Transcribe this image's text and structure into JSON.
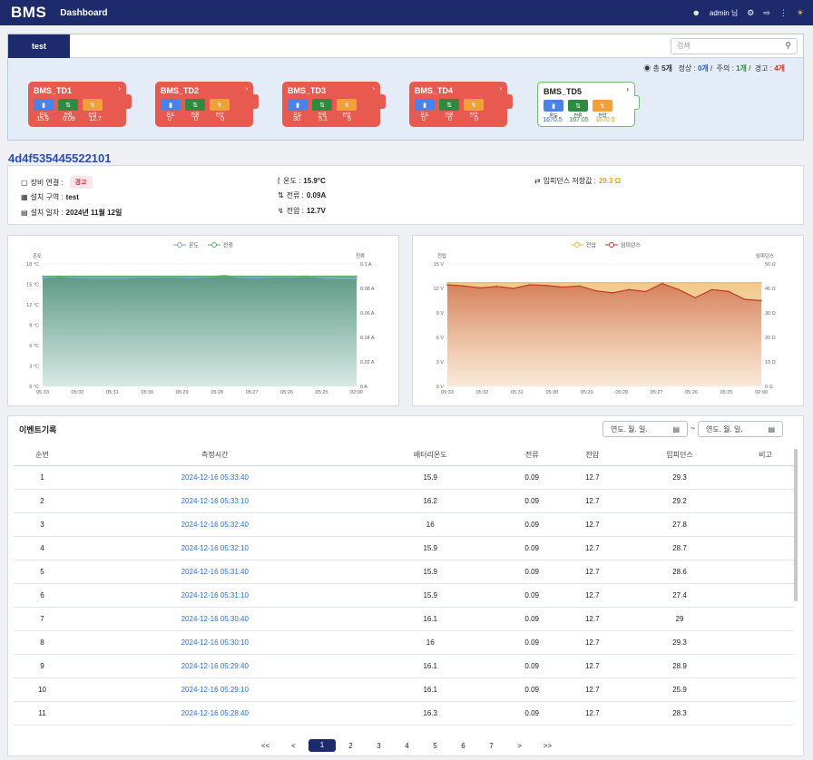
{
  "topbar": {
    "logo": "BMS",
    "crumb": "Dashboard",
    "user": "admin 님"
  },
  "tab": {
    "label": "test"
  },
  "search": {
    "placeholder": "검색"
  },
  "summary": {
    "total_prefix": "총",
    "total": "5개",
    "normal_label": "정상 :",
    "normal": "0개",
    "warn_label": "주의 :",
    "warn": "1개",
    "alarm_label": "경고 :",
    "alarm": "4개"
  },
  "devices": [
    {
      "name": "BMS_TD1",
      "labels": [
        "온도",
        "전류",
        "전압"
      ],
      "values": [
        "15.9",
        "0.09",
        "12.7"
      ],
      "status": "alarm"
    },
    {
      "name": "BMS_TD2",
      "labels": [
        "온도",
        "전류",
        "전압"
      ],
      "values": [
        "0",
        "0",
        "0"
      ],
      "status": "alarm"
    },
    {
      "name": "BMS_TD3",
      "labels": [
        "온도",
        "전류",
        "전압"
      ],
      "values": [
        "30",
        "5.1",
        "5"
      ],
      "status": "alarm"
    },
    {
      "name": "BMS_TD4",
      "labels": [
        "온도",
        "전류",
        "전압"
      ],
      "values": [
        "0",
        "0",
        "0"
      ],
      "status": "alarm"
    },
    {
      "name": "BMS_TD5",
      "labels": [
        "온도",
        "전류",
        "전압"
      ],
      "values": [
        "1670.5",
        "167.05",
        "1670.5"
      ],
      "status": "warn"
    }
  ],
  "device_id": "4d4f535445522101",
  "info": {
    "conn_label": "장비 연결 :",
    "conn_badge": "경고",
    "zone_label": "설치 구역 :",
    "zone": "test",
    "date_label": "설치 일자 :",
    "date": "2024년 11월 12일",
    "temp_label": "온도 :",
    "temp": "15.9°C",
    "curr_label": "전류 :",
    "curr": "0.09A",
    "volt_label": "전압 :",
    "volt": "12.7V",
    "imp_label": "임피던스 저항값 :",
    "imp": "29.3 Ω"
  },
  "colors": {
    "accent": "#1d2a6b",
    "alarm": "#e85a4f",
    "link": "#2b6fd6"
  },
  "chart_data": [
    {
      "type": "area",
      "legend": [
        "온도",
        "전류"
      ],
      "ylabel_left": "온도",
      "ylabel_right": "전류",
      "yticks_left": [
        "18 °C",
        "15 °C",
        "12 °C",
        "9 °C",
        "6 °C",
        "3 °C",
        "0 °C"
      ],
      "yticks_right": [
        "0.1 A",
        "0.08 A",
        "0.06 A",
        "0.04 A",
        "0.02 A",
        "0 A"
      ],
      "x": [
        "05:33",
        "05:32",
        "05:31",
        "05:30",
        "05:29",
        "05:28",
        "05:27",
        "05:26",
        "05:25",
        "02:00"
      ],
      "series": [
        {
          "name": "온도",
          "values": [
            15.9,
            16.2,
            16.0,
            15.9,
            15.9,
            15.9,
            16.1,
            16.0,
            16.1,
            15.9,
            16.1,
            16.3,
            16.0,
            15.9,
            16.1,
            16.0,
            16.2,
            15.9,
            15.8,
            15.8
          ]
        },
        {
          "name": "전류",
          "values": [
            0.09,
            0.09,
            0.09,
            0.09,
            0.09,
            0.09,
            0.09,
            0.09,
            0.09,
            0.09,
            0.09,
            0.09,
            0.09,
            0.09,
            0.09,
            0.09,
            0.09,
            0.09,
            0.09,
            0.09
          ]
        }
      ],
      "ylim_left": [
        0,
        18
      ],
      "ylim_right": [
        0,
        0.1
      ]
    },
    {
      "type": "area",
      "legend": [
        "전압",
        "임피던스"
      ],
      "ylabel_left": "전압",
      "ylabel_right": "임피던스",
      "yticks_left": [
        "15 V",
        "12 V",
        "9 V",
        "6 V",
        "3 V",
        "0 V"
      ],
      "yticks_right": [
        "50 Ω",
        "40 Ω",
        "30 Ω",
        "20 Ω",
        "10 Ω",
        "0 Ω"
      ],
      "x": [
        "05:33",
        "05:32",
        "05:31",
        "05:30",
        "05:29",
        "05:28",
        "05:27",
        "05:26",
        "05:25",
        "02:00"
      ],
      "series": [
        {
          "name": "전압",
          "values": [
            12.7,
            12.7,
            12.7,
            12.7,
            12.7,
            12.7,
            12.7,
            12.7,
            12.7,
            12.7,
            12.7,
            12.7,
            12.7,
            12.7,
            12.7,
            12.7,
            12.7,
            12.7,
            12.7,
            12.7
          ]
        },
        {
          "name": "임피던스",
          "values": [
            41.5,
            41.0,
            40.2,
            40.8,
            40.0,
            41.5,
            41.2,
            40.5,
            41.0,
            39.0,
            38.2,
            39.5,
            38.7,
            42.0,
            39.5,
            36.2,
            39.5,
            38.8,
            35.5,
            35.0
          ]
        }
      ],
      "ylim_left": [
        0,
        15
      ],
      "ylim_right": [
        0,
        50
      ]
    }
  ],
  "events": {
    "title": "이벤트기록",
    "date_placeholder": "연도. 월. 일.",
    "columns": [
      "순번",
      "측정시간",
      "배터리온도",
      "전류",
      "전압",
      "임피던스",
      "비고"
    ],
    "rows": [
      [
        "1",
        "2024-12-16 05:33:40",
        "15.9",
        "0.09",
        "12.7",
        "29.3",
        ""
      ],
      [
        "2",
        "2024-12-16 05:33:10",
        "16.2",
        "0.09",
        "12.7",
        "29.2",
        ""
      ],
      [
        "3",
        "2024-12-16 05:32:40",
        "16",
        "0.09",
        "12.7",
        "27.8",
        ""
      ],
      [
        "4",
        "2024-12-16 05:32:10",
        "15.9",
        "0.09",
        "12.7",
        "28.7",
        ""
      ],
      [
        "5",
        "2024-12-16 05:31:40",
        "15.9",
        "0.09",
        "12.7",
        "28.6",
        ""
      ],
      [
        "6",
        "2024-12-16 05:31:10",
        "15.9",
        "0.09",
        "12.7",
        "27.4",
        ""
      ],
      [
        "7",
        "2024-12-16 05:30:40",
        "16.1",
        "0.09",
        "12.7",
        "29",
        ""
      ],
      [
        "8",
        "2024-12-16 05:30:10",
        "16",
        "0.09",
        "12.7",
        "29.3",
        ""
      ],
      [
        "9",
        "2024-12-16 05:29:40",
        "16.1",
        "0.09",
        "12.7",
        "28.9",
        ""
      ],
      [
        "10",
        "2024-12-16 05:29:10",
        "16.1",
        "0.09",
        "12.7",
        "25.9",
        ""
      ],
      [
        "11",
        "2024-12-16 05:28:40",
        "16.3",
        "0.09",
        "12.7",
        "28.3",
        ""
      ]
    ],
    "pager": [
      "<<",
      "<",
      "1",
      "2",
      "3",
      "4",
      "5",
      "6",
      "7",
      ">",
      ">>"
    ],
    "current_page": "1"
  }
}
